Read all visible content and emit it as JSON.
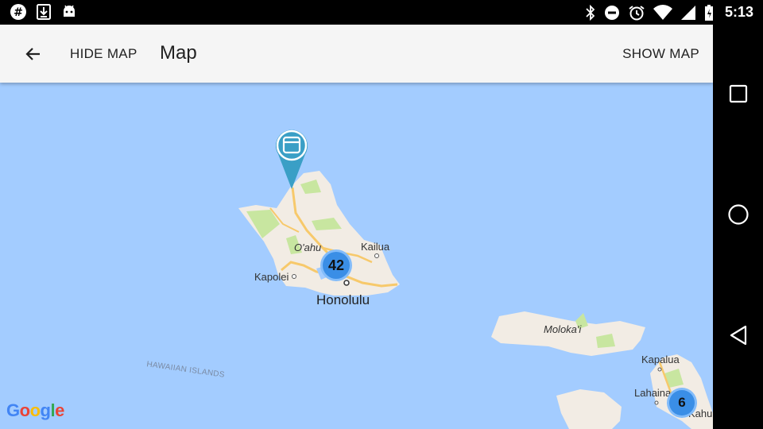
{
  "status_bar": {
    "time": "5:13",
    "left_icons": [
      "slack-icon",
      "download-icon",
      "android-icon"
    ],
    "right_icons": [
      "bluetooth-icon",
      "do-not-disturb-icon",
      "alarm-icon",
      "wifi-icon",
      "signal-icon",
      "battery-charging-icon"
    ]
  },
  "appbar": {
    "back_icon": "arrow-back-icon",
    "hide_map_label": "HIDE MAP",
    "title": "Map",
    "show_map_label": "SHOW MAP"
  },
  "map": {
    "labels": {
      "oahu": "O'ahu",
      "kailua": "Kailua",
      "kapolei": "Kapolei",
      "honolulu": "Honolulu",
      "molokai": "Moloka'i",
      "kapalua": "Kapalua",
      "lahaina": "Lahaina",
      "kahului": "Kahu",
      "hawaiian_islands": "HAWAIIAN ISLANDS"
    },
    "clusters": [
      {
        "id": "oahu",
        "count": "42"
      },
      {
        "id": "maui",
        "count": "6"
      }
    ],
    "pin_icon": "calendar-icon",
    "attribution": [
      "G",
      "o",
      "o",
      "g",
      "l",
      "e"
    ],
    "colors": {
      "water": "#a3ccff",
      "land": "#f2ece4",
      "park": "#c8e6a0",
      "road": "#f7c96b",
      "cluster": "#3a8ee6",
      "pin": "#3a9fc6"
    }
  },
  "nav_bar": {
    "icons": [
      "recents-square-icon",
      "home-circle-icon",
      "back-triangle-icon"
    ]
  }
}
